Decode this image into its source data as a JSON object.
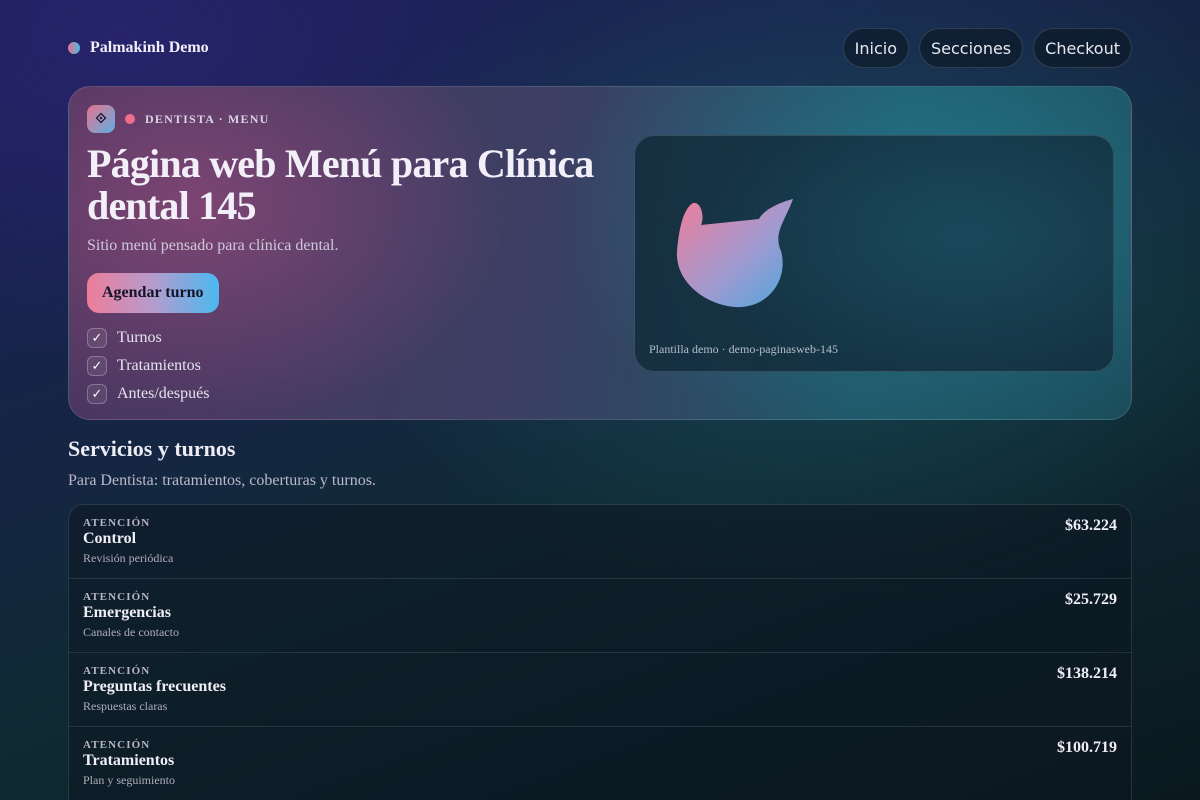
{
  "header": {
    "brand": "Palmakinh Demo",
    "nav": [
      "Inicio",
      "Secciones",
      "Checkout"
    ]
  },
  "hero": {
    "logo_glyph": "⟐",
    "kicker": "DENTISTA · MENU",
    "title": "Página web Menú para Clínica dental 145",
    "subtitle": "Sitio menú pensado para clínica dental.",
    "cta": "Agendar turno",
    "features": [
      "Turnos",
      "Tratamientos",
      "Antes/después"
    ],
    "check_glyph": "✓",
    "preview_caption": "Plantilla demo · demo-paginasweb-145"
  },
  "services": {
    "title": "Servicios y turnos",
    "description": "Para Dentista: tratamientos, coberturas y turnos.",
    "items": [
      {
        "tag": "ATENCIÓN",
        "name": "Control",
        "note": "Revisión periódica",
        "price": "$63.224"
      },
      {
        "tag": "ATENCIÓN",
        "name": "Emergencias",
        "note": "Canales de contacto",
        "price": "$25.729"
      },
      {
        "tag": "ATENCIÓN",
        "name": "Preguntas frecuentes",
        "note": "Respuestas claras",
        "price": "$138.214"
      },
      {
        "tag": "ATENCIÓN",
        "name": "Tratamientos",
        "note": "Plan y seguimiento",
        "price": "$100.719"
      }
    ]
  },
  "colors": {
    "accent_pink": "#ee7d9a",
    "accent_blue": "#4ab8f0",
    "kicker_dot": "#ef6d8d"
  },
  "icons": {
    "brand": "gradient-dot-icon",
    "logo": "diamond-logo-icon",
    "check": "check-icon",
    "preview_art": "abstract-gradient-shape"
  }
}
